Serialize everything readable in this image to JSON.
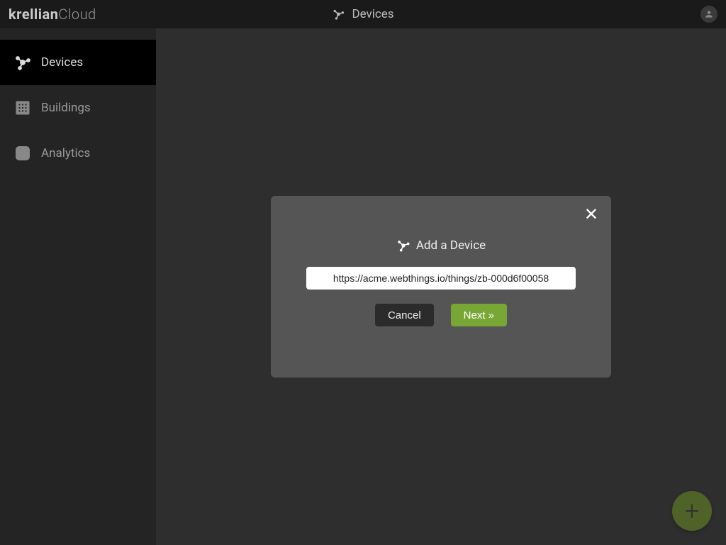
{
  "brand": {
    "bold": "krellian",
    "light": "Cloud"
  },
  "header": {
    "title": "Devices"
  },
  "sidebar": {
    "items": [
      {
        "label": "Devices",
        "icon": "devices-icon",
        "active": true
      },
      {
        "label": "Buildings",
        "icon": "buildings-icon",
        "active": false
      },
      {
        "label": "Analytics",
        "icon": "analytics-icon",
        "active": false
      }
    ]
  },
  "modal": {
    "title": "Add a Device",
    "url_value": "https://acme.webthings.io/things/zb-000d6f00058",
    "cancel_label": "Cancel",
    "next_label": "Next »",
    "close_glyph": "✕"
  },
  "fab": {
    "glyph": "+"
  },
  "colors": {
    "accent": "#79a736"
  }
}
